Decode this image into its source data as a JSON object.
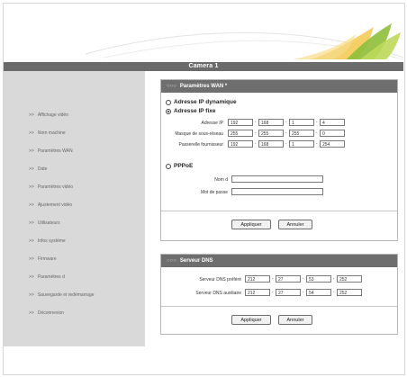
{
  "header": {
    "title": "Camera 1"
  },
  "sidebar": {
    "arrow": ">>",
    "items": [
      {
        "label": "Affichage vidéo"
      },
      {
        "label": "Nom machine"
      },
      {
        "label": "Paramètres WAN"
      },
      {
        "label": "Date"
      },
      {
        "label": "Paramètres vidéo"
      },
      {
        "label": "Ajustement vidéo"
      },
      {
        "label": "Utilisateurs"
      },
      {
        "label": "Infos système"
      },
      {
        "label": "Firmware"
      },
      {
        "label": "Paramètres d"
      },
      {
        "label": "Sauvegarde et redémarrage"
      },
      {
        "label": "Déconnexion"
      }
    ]
  },
  "wan": {
    "title": "Paramètres WAN *",
    "dynamic_label": "Adresse IP dynamique",
    "fixed_label": "Adresse IP fixe",
    "selected": "fixed",
    "ip_label": "Adresse IP",
    "ip": [
      "192",
      "168",
      "1",
      "4"
    ],
    "mask_label": "Masque de sous-réseau",
    "mask": [
      "255",
      "255",
      "255",
      "0"
    ],
    "gw_label": "Passerelle fournisseur",
    "gw": [
      "192",
      "168",
      "1",
      "254"
    ],
    "pppoe_label": "PPPoE",
    "user_label": "Nom d",
    "user_value": "",
    "pass_label": "Mot de passe",
    "pass_value": "",
    "apply_label": "Appliquer",
    "cancel_label": "Annuler"
  },
  "dns": {
    "title": "Serveur DNS",
    "primary_label": "Serveur DNS préféré",
    "primary": [
      "212",
      "27",
      "53",
      "252"
    ],
    "secondary_label": "Serveur DNS auxiliaire",
    "secondary": [
      "212",
      "27",
      "54",
      "252"
    ],
    "apply_label": "Appliquer",
    "cancel_label": "Annuler"
  },
  "colors": {
    "titlebar": "#6b6b6b",
    "sidebar": "#d9d9d9",
    "panel_head": "#6e6e6e",
    "accent_green": "#9fc43a"
  }
}
